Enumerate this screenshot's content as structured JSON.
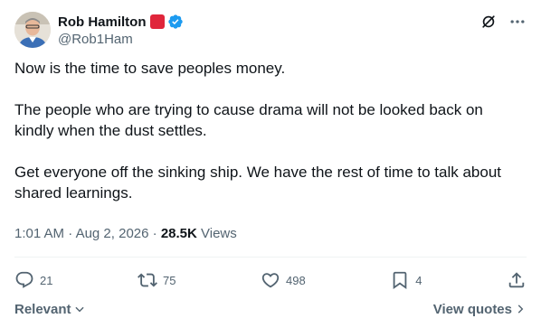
{
  "author": {
    "display_name": "Rob Hamilton",
    "handle": "@Rob1Ham",
    "badge_color": "#e0263b",
    "verified_color": "#1d9bf0"
  },
  "tweet": {
    "text": "Now is the time to save peoples money.\n\nThe people who are trying to cause drama will not be looked back on kindly when the dust settles.\n\nGet everyone off the sinking ship. We have the rest of time to talk about shared learnings."
  },
  "meta": {
    "time": "1:01 AM",
    "date": "Aug 2, 2026",
    "separator": "·",
    "views_count": "28.5K",
    "views_label": "Views"
  },
  "actions": {
    "replies": "21",
    "reposts": "75",
    "likes": "498",
    "bookmarks": "4"
  },
  "footer": {
    "sort_label": "Relevant",
    "quotes_label": "View quotes"
  },
  "colors": {
    "text": "#0f1419",
    "secondary": "#536471",
    "divider": "#eff3f4"
  }
}
